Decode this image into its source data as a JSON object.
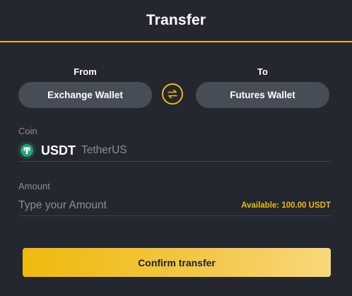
{
  "header": {
    "title": "Transfer"
  },
  "from": {
    "label": "From",
    "wallet": "Exchange Wallet"
  },
  "to": {
    "label": "To",
    "wallet": "Futures Wallet"
  },
  "swap": {
    "icon": "swap-arrows-icon"
  },
  "coin": {
    "label": "Coin",
    "symbol": "USDT",
    "name": "TetherUS",
    "icon": "tether-icon",
    "icon_color": "#26A17B"
  },
  "amount": {
    "label": "Amount",
    "value": "",
    "placeholder": "Type your Amount",
    "available": "Available: 100.00 USDT"
  },
  "confirm": {
    "label": "Confirm transfer"
  },
  "colors": {
    "background": "#242730",
    "accent": "#F0B90B",
    "pill": "#474D57",
    "muted_text": "#848E9C"
  }
}
